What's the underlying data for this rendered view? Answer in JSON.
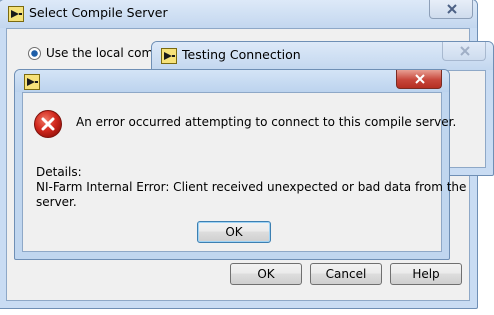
{
  "select_window": {
    "title": "Select Compile Server",
    "radio_label": "Use the local compile",
    "ok_label": "OK",
    "cancel_label": "Cancel",
    "help_label": "Help"
  },
  "testing_window": {
    "title": "Testing Connection"
  },
  "error_dialog": {
    "message": "An error occurred attempting to connect to this compile server.",
    "details_heading": "Details:",
    "details_line1": "NI-Farm Internal Error:  Client received unexpected or bad data from the",
    "details_line2": "server.",
    "ok_label": "OK"
  },
  "icons": {
    "app_icon": "labview-app-icon",
    "error_icon": "error-x-icon",
    "close_icon": "close-x-icon"
  },
  "colors": {
    "error_red": "#d2281e",
    "close_red": "#c7463b",
    "window_frame": "#c9dcf3"
  }
}
